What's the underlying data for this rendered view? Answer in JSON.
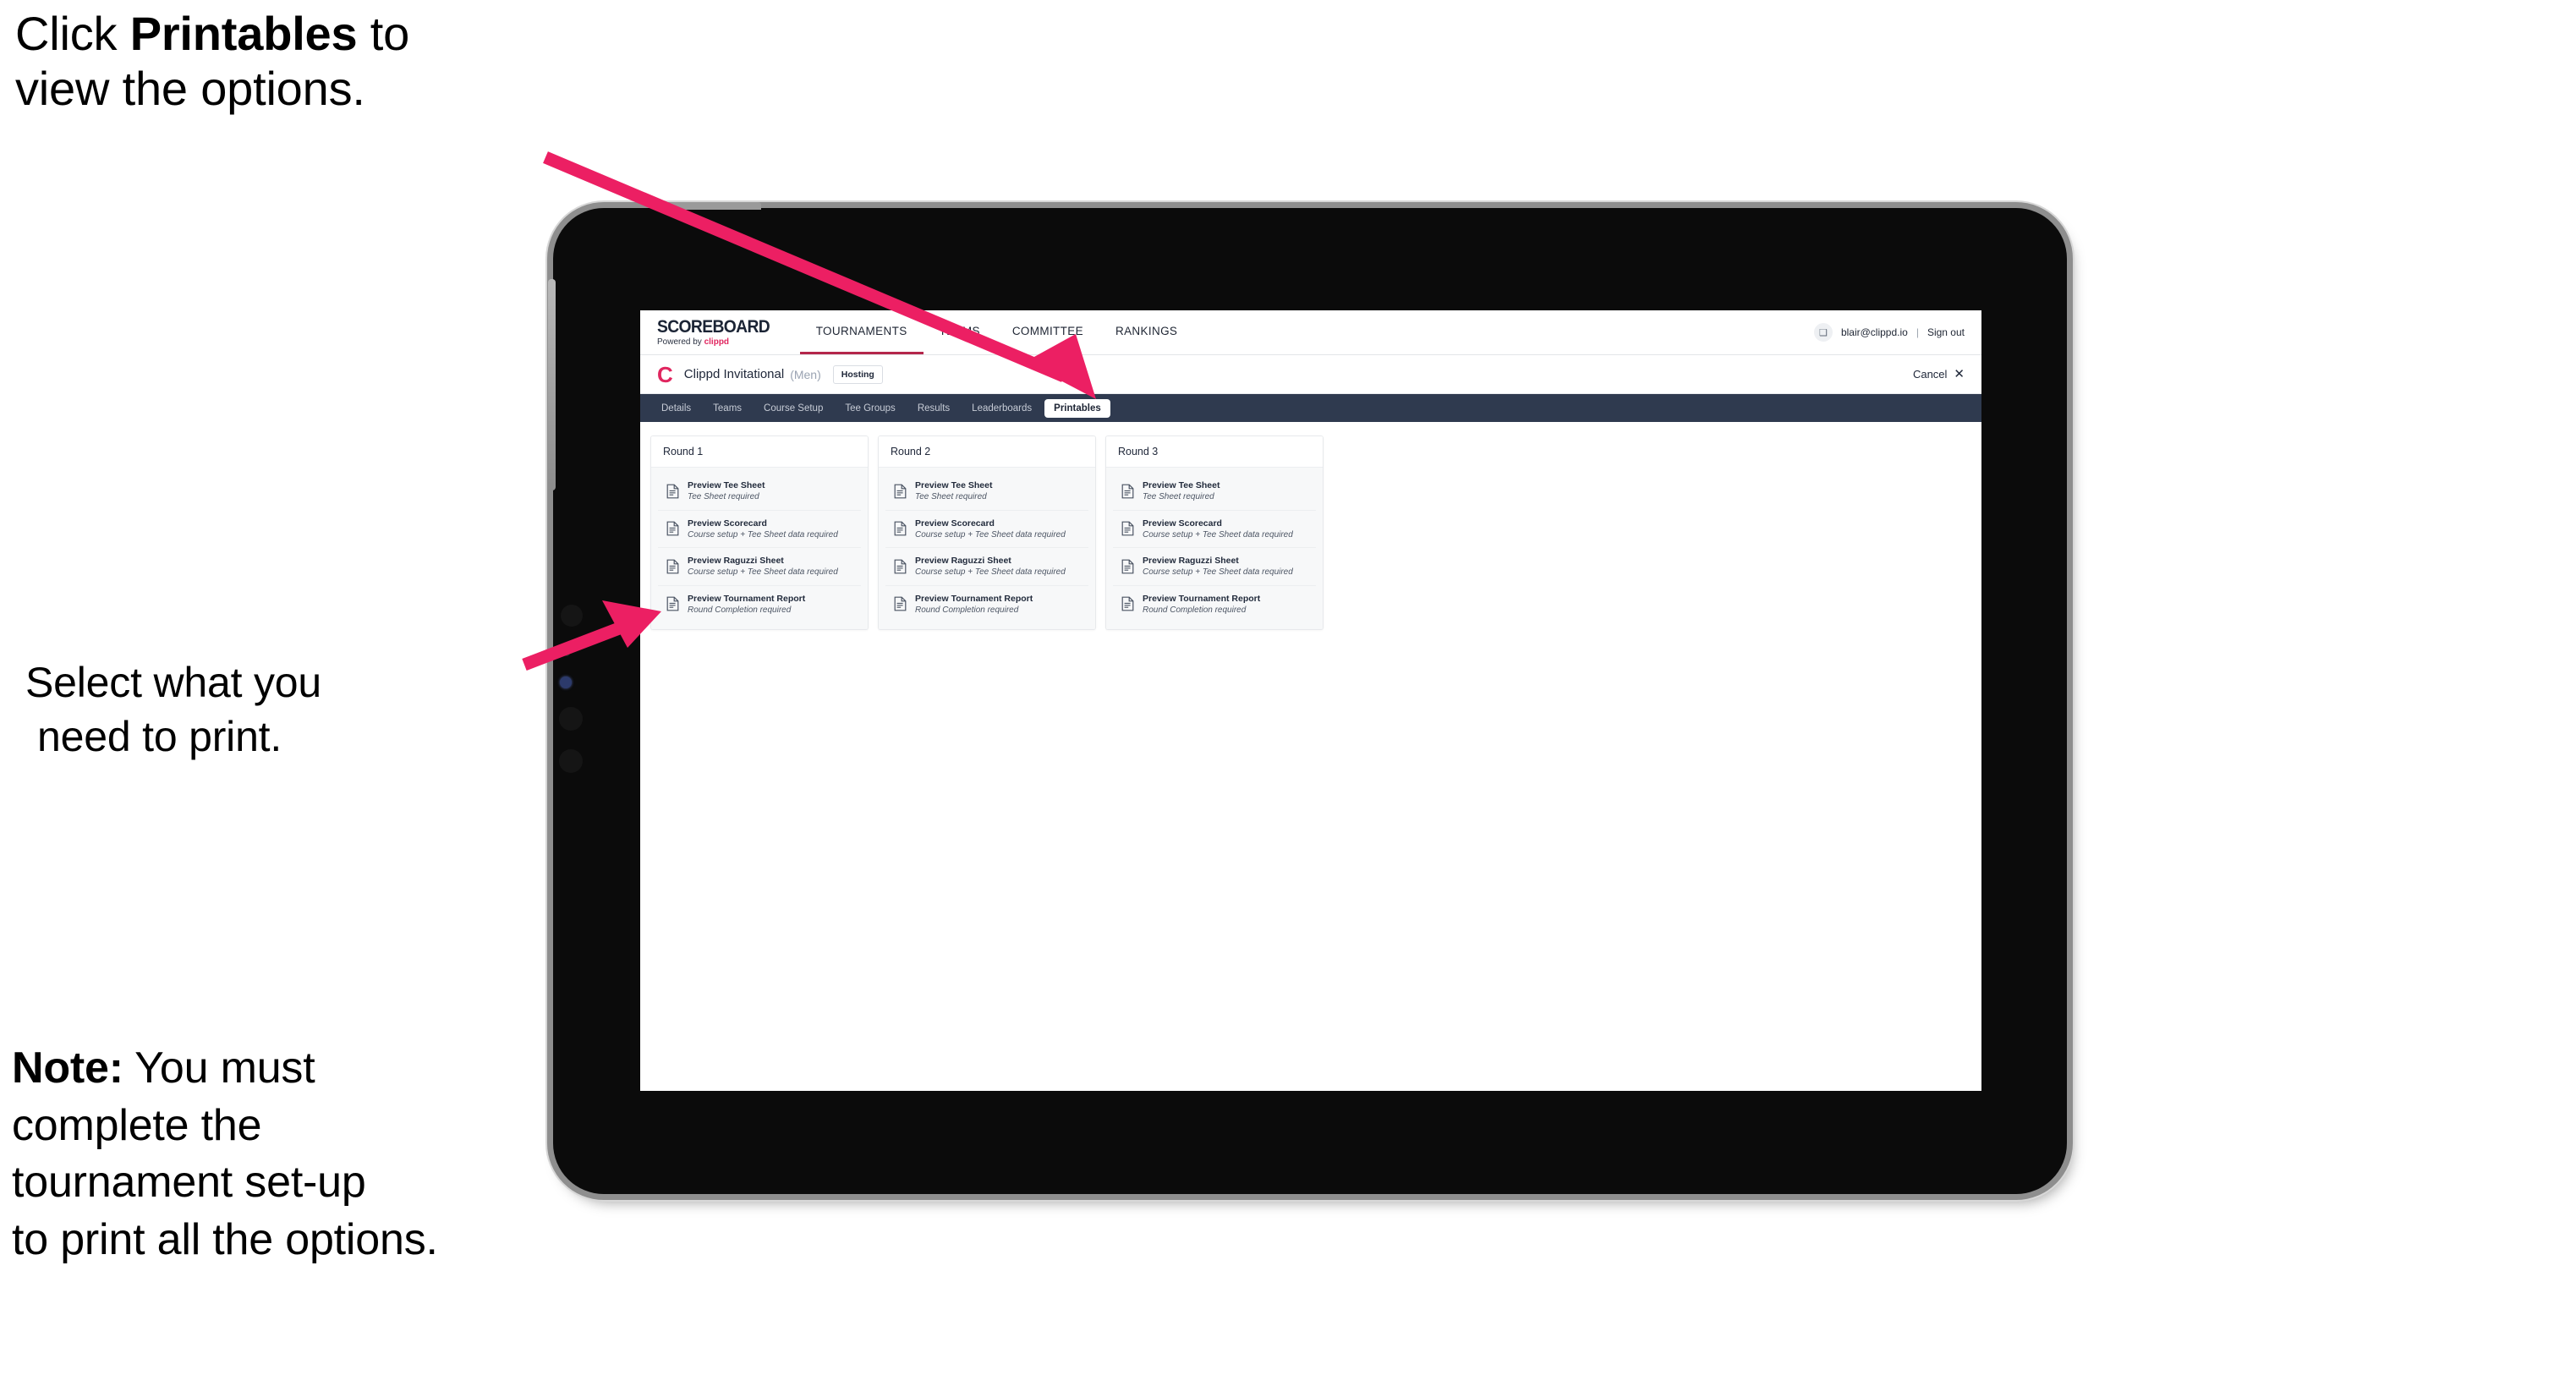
{
  "annotations": {
    "top": {
      "pre": "Click ",
      "bold": "Printables",
      "post": " to",
      "line2": "view the options."
    },
    "middle": {
      "line1": "Select what you",
      "line2": "need to print."
    },
    "note": {
      "bold": "Note:",
      "rest": " You must",
      "line2": "complete the",
      "line3": "tournament set-up",
      "line4": "to print all the options."
    }
  },
  "app": {
    "brand": {
      "name": "SCOREBOARD",
      "powered_prefix": "Powered by ",
      "powered_brand": "clippd"
    },
    "topnav": [
      {
        "label": "TOURNAMENTS",
        "active": true
      },
      {
        "label": "TEAMS",
        "active": false
      },
      {
        "label": "COMMITTEE",
        "active": false
      },
      {
        "label": "RANKINGS",
        "active": false
      }
    ],
    "user": {
      "avatar_glyph": "❑",
      "email": "blair@clippd.io",
      "separator": "|",
      "signout": "Sign out"
    },
    "tournament": {
      "logo_letter": "C",
      "name": "Clippd Invitational",
      "gender": "(Men)",
      "status_badge": "Hosting",
      "cancel_label": "Cancel",
      "cancel_icon": "✕"
    },
    "tabs": [
      {
        "label": "Details",
        "active": false
      },
      {
        "label": "Teams",
        "active": false
      },
      {
        "label": "Course Setup",
        "active": false
      },
      {
        "label": "Tee Groups",
        "active": false
      },
      {
        "label": "Results",
        "active": false
      },
      {
        "label": "Leaderboards",
        "active": false
      },
      {
        "label": "Printables",
        "active": true
      }
    ],
    "rounds": [
      {
        "title": "Round 1",
        "items": [
          {
            "title": "Preview Tee Sheet",
            "subtitle": "Tee Sheet required"
          },
          {
            "title": "Preview Scorecard",
            "subtitle": "Course setup + Tee Sheet data required"
          },
          {
            "title": "Preview Raguzzi Sheet",
            "subtitle": "Course setup + Tee Sheet data required"
          },
          {
            "title": "Preview Tournament Report",
            "subtitle": "Round Completion required"
          }
        ]
      },
      {
        "title": "Round 2",
        "items": [
          {
            "title": "Preview Tee Sheet",
            "subtitle": "Tee Sheet required"
          },
          {
            "title": "Preview Scorecard",
            "subtitle": "Course setup + Tee Sheet data required"
          },
          {
            "title": "Preview Raguzzi Sheet",
            "subtitle": "Course setup + Tee Sheet data required"
          },
          {
            "title": "Preview Tournament Report",
            "subtitle": "Round Completion required"
          }
        ]
      },
      {
        "title": "Round 3",
        "items": [
          {
            "title": "Preview Tee Sheet",
            "subtitle": "Tee Sheet required"
          },
          {
            "title": "Preview Scorecard",
            "subtitle": "Course setup + Tee Sheet data required"
          },
          {
            "title": "Preview Raguzzi Sheet",
            "subtitle": "Course setup + Tee Sheet data required"
          },
          {
            "title": "Preview Tournament Report",
            "subtitle": "Round Completion required"
          }
        ]
      }
    ]
  },
  "colors": {
    "accent_pink": "#ec1f63",
    "brand_pink": "#e0265f",
    "tabstrip_dark": "#2f3a4f",
    "active_underline": "#b4264b",
    "panel_grey": "#f7f8f9"
  }
}
